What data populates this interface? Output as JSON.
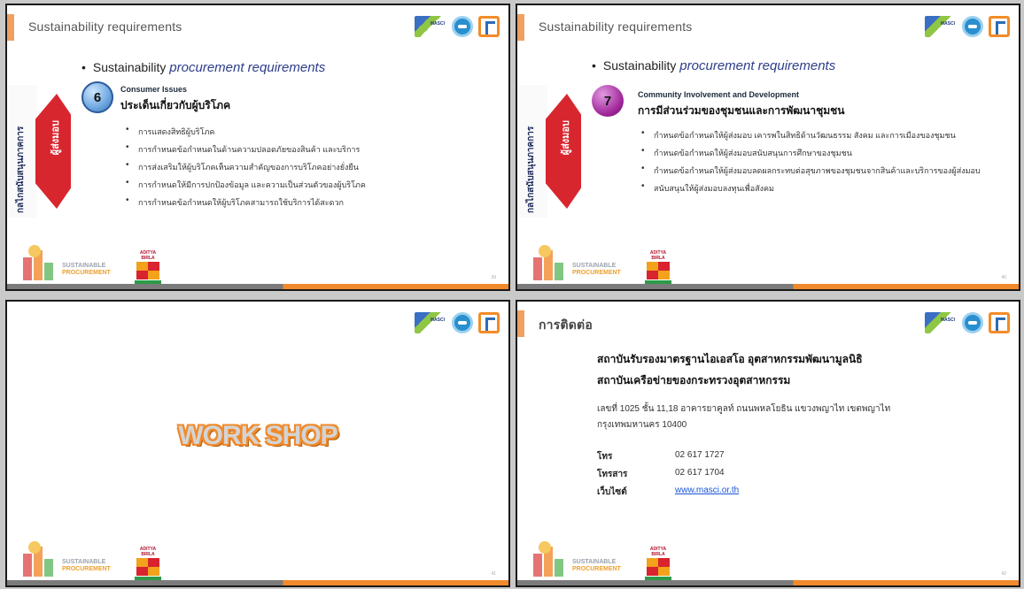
{
  "slide1": {
    "header_title": "Sustainability  requirements",
    "side_tab_label": "กลไกสนับสนุนภาคการ",
    "red_tab_label": "ผู้ส่งมอบ",
    "bullet_prefix": "Sustainability",
    "bullet_italic": "procurement  requirements",
    "badge_number": "6",
    "topic_en": "Consumer Issues",
    "topic_th": "ประเด็นเกี่ยวกับผู้บริโภค",
    "items": [
      "การแสดงสิทธิผู้บริโภค",
      "การกำหนดข้อกำหนดในด้านความปลอดภัยของสินค้า และบริการ",
      "การส่งเสริมให้ผู้บริโภคเห็นความสำคัญของการบริโภคอย่างยั่งยืน",
      "การกำหนดให้มีการปกป้องข้อมูล และความเป็นส่วนตัวของผู้บริโภค",
      "การกำหนดข้อกำหนดให้ผู้บริโภคสามารถใช้บริการได้สะดวก"
    ],
    "page_number": "39"
  },
  "slide2": {
    "header_title": "Sustainability  requirements",
    "side_tab_label": "กลไกสนับสนุนภาคการ",
    "red_tab_label": "ผู้ส่งมอบ",
    "bullet_prefix": "Sustainability",
    "bullet_italic": "procurement  requirements",
    "badge_number": "7",
    "topic_en": "Community Involvement and Development",
    "topic_th": "การมีส่วนร่วมของชุมชนและการพัฒนาชุมชน",
    "items": [
      "กำหนดข้อกำหนดให้ผู้ส่งมอบ เคารพในสิทธิด้านวัฒนธรรม สังคม และการเมืองของชุมชน",
      "กำหนดข้อกำหนดให้ผู้ส่งมอบสนับสนุนการศึกษาของชุมชน",
      "กำหนดข้อกำหนดให้ผู้ส่งมอบลดผลกระทบต่อสุขภาพของชุมชนจากสินค้าและบริการของผู้ส่งมอบ",
      "สนับสนุนให้ผู้ส่งมอบลงทุนเพื่อสังคม"
    ],
    "page_number": "40"
  },
  "slide3": {
    "workshop_text": "WORK SHOP",
    "page_number": "41"
  },
  "slide4": {
    "header_title": "การติดต่อ",
    "org_line1": "สถาบันรับรองมาตรฐานไอเอสโอ อุตสาหกรรมพัฒนามูลนิธิ",
    "org_line2": "สถาบันเครือข่ายของกระทรวงอุตสาหกรรม",
    "address_line1": "เลขที่ 1025 ชั้น 11,18 อาคารยาคูลท์ ถนนพหลโยธิน แขวงพญาไท เขตพญาไท",
    "address_line2": "กรุงเทพมหานคร 10400",
    "tel_label": "โทร",
    "tel_value": "02 617 1727",
    "fax_label": "โทรสาร",
    "fax_value": "02 617 1704",
    "web_label": "เว็บไซต์",
    "web_value": "www.masci.or.th",
    "page_number": "42"
  },
  "footer": {
    "sp_line1": "SUSTAINABLE",
    "sp_line2": "PROCUREMENT",
    "ab_brand": "ADITYA BIRLA",
    "ab_sub": "CHEMICALS"
  },
  "logos": {
    "masci_text": "MASCI"
  },
  "colors": {
    "accent_orange": "#f08a2c",
    "red_tab": "#d8262f",
    "italic_blue": "#2d3e8a",
    "link_blue": "#1a55d8"
  }
}
